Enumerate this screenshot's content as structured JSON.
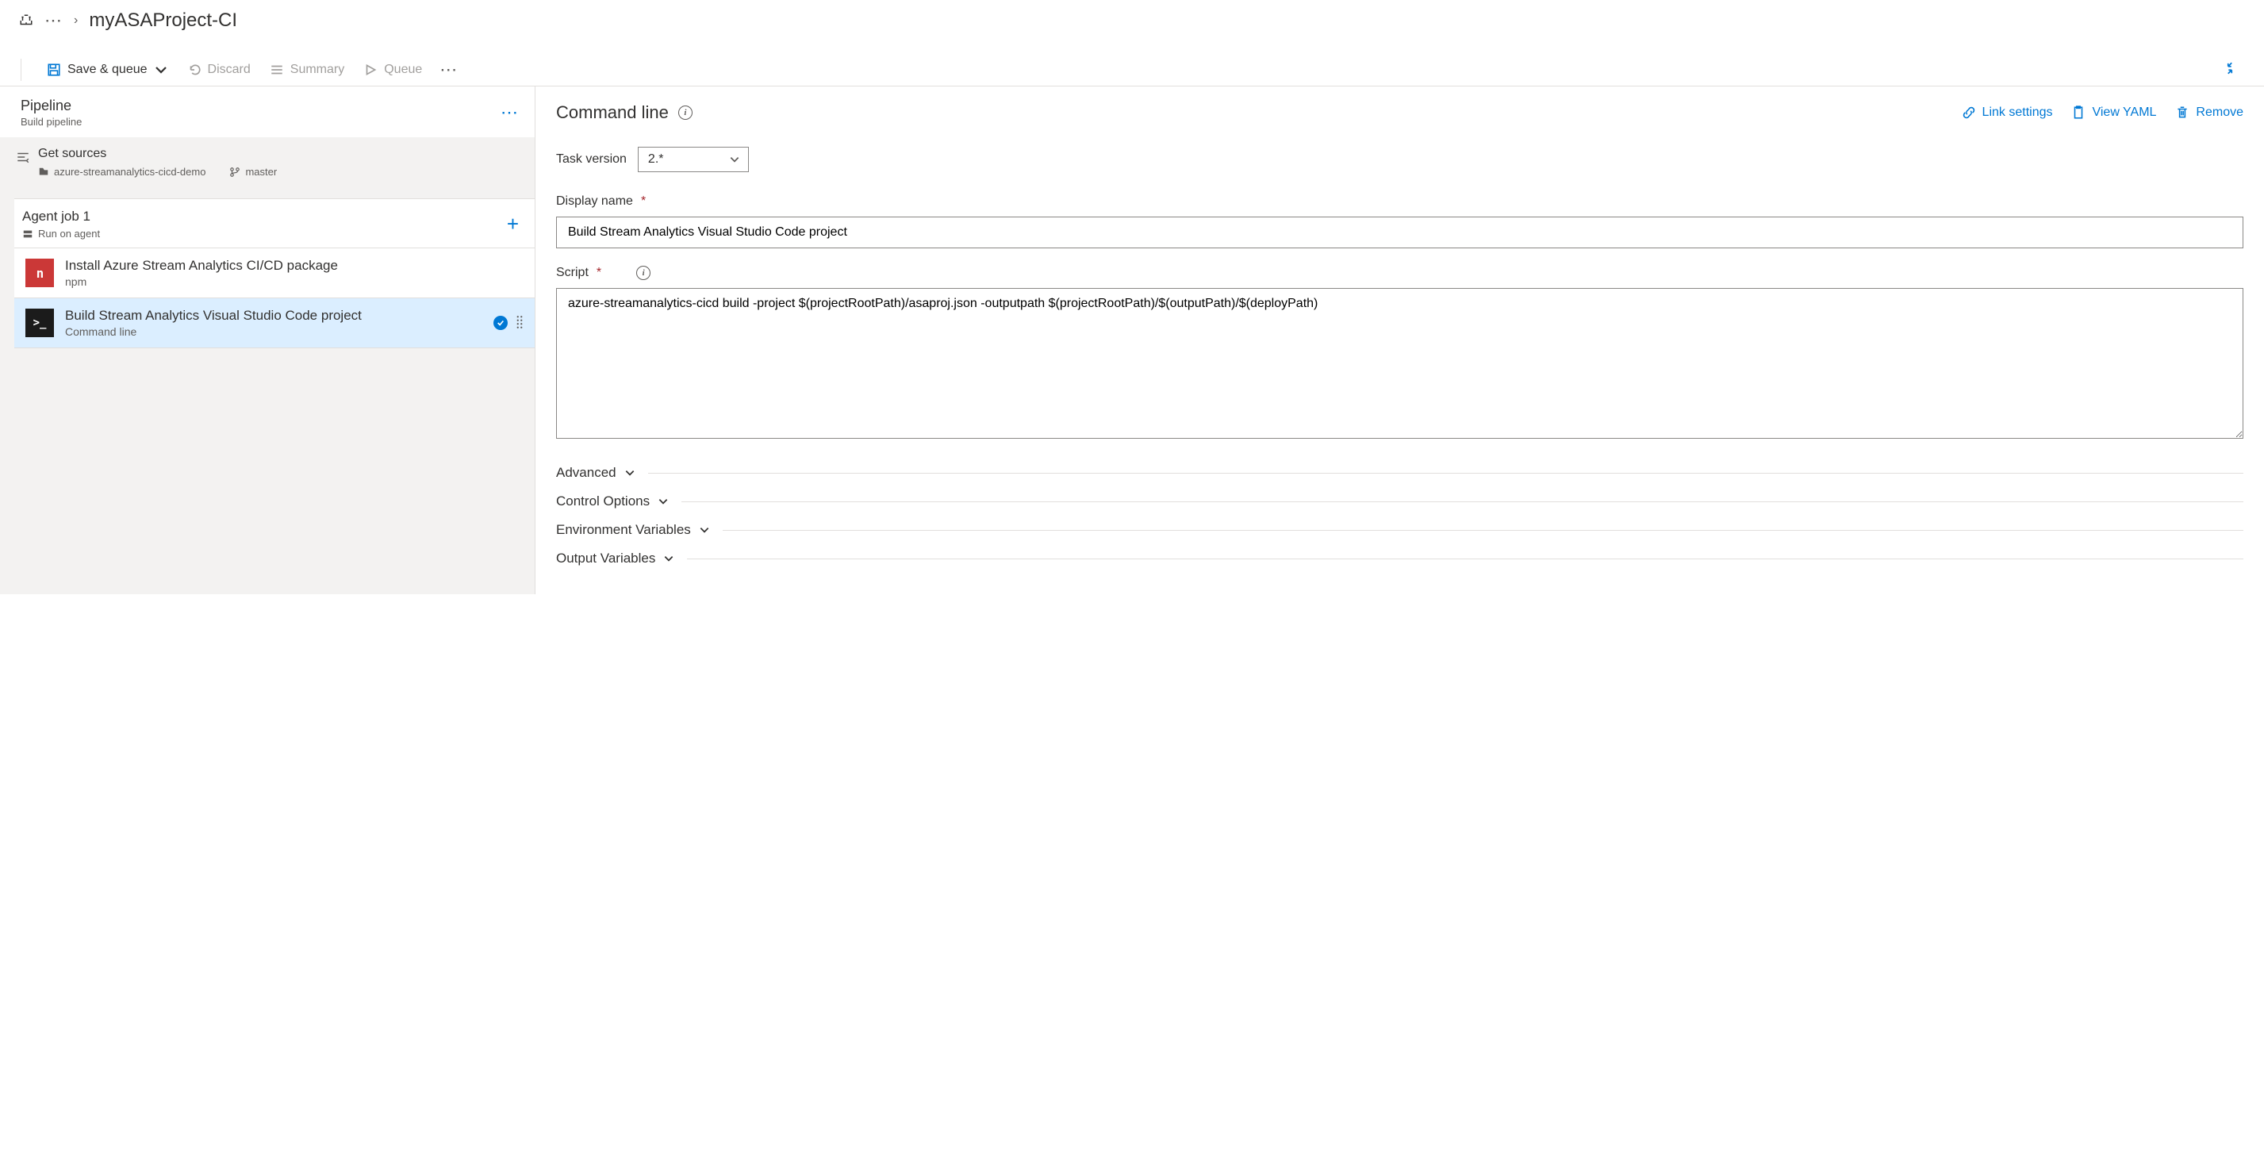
{
  "breadcrumb": {
    "title": "myASAProject-CI"
  },
  "toolbar": {
    "save_queue": "Save & queue",
    "discard": "Discard",
    "summary": "Summary",
    "queue": "Queue"
  },
  "pipeline_header": {
    "title": "Pipeline",
    "subtitle": "Build pipeline"
  },
  "get_sources": {
    "title": "Get sources",
    "repo": "azure-streamanalytics-cicd-demo",
    "branch": "master"
  },
  "agent_job": {
    "title": "Agent job 1",
    "subtitle": "Run on agent"
  },
  "tasks": [
    {
      "label": "Install Azure Stream Analytics CI/CD package",
      "sublabel": "npm",
      "icon": "npm",
      "icon_text": "n",
      "selected": false
    },
    {
      "label": "Build Stream Analytics Visual Studio Code project",
      "sublabel": "Command line",
      "icon": "cmd",
      "icon_text": ">_",
      "selected": true
    }
  ],
  "detail": {
    "title": "Command line",
    "actions": {
      "link_settings": "Link settings",
      "view_yaml": "View YAML",
      "remove": "Remove"
    },
    "task_version_label": "Task version",
    "task_version_value": "2.*",
    "display_name_label": "Display name",
    "display_name_value": "Build Stream Analytics Visual Studio Code project",
    "script_label": "Script",
    "script_value": "azure-streamanalytics-cicd build -project $(projectRootPath)/asaproj.json -outputpath $(projectRootPath)/$(outputPath)/$(deployPath)",
    "expanders": [
      "Advanced",
      "Control Options",
      "Environment Variables",
      "Output Variables"
    ]
  }
}
